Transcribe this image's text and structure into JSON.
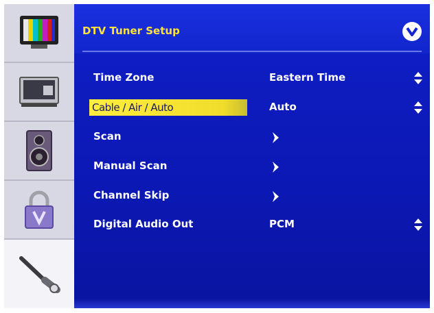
{
  "header": {
    "title": "DTV Tuner Setup",
    "logo_icon": "vizio-v-logo-icon"
  },
  "sidebar": {
    "items": [
      {
        "name": "picture",
        "icon": "color-bars-tv-icon",
        "active": false
      },
      {
        "name": "input",
        "icon": "monitor-input-icon",
        "active": false
      },
      {
        "name": "audio",
        "icon": "speaker-icon",
        "active": false
      },
      {
        "name": "parental",
        "icon": "padlock-icon",
        "active": false
      },
      {
        "name": "setup",
        "icon": "wrench-icon",
        "active": true
      }
    ]
  },
  "menu": {
    "items": [
      {
        "label": "Time Zone",
        "value": "Eastern Time",
        "control": "updown",
        "selected": false
      },
      {
        "label": "Cable / Air / Auto",
        "value": "Auto",
        "control": "updown",
        "selected": true
      },
      {
        "label": "Scan",
        "value": "",
        "control": "arrow",
        "selected": false
      },
      {
        "label": "Manual Scan",
        "value": "",
        "control": "arrow",
        "selected": false
      },
      {
        "label": "Channel Skip",
        "value": "",
        "control": "arrow",
        "selected": false
      },
      {
        "label": "Digital Audio Out",
        "value": "PCM",
        "control": "updown",
        "selected": false
      }
    ]
  },
  "colors": {
    "panel": "#1020c8",
    "title": "#ffe23a",
    "highlight": "#ffee40",
    "sidebar": "#d8d8e4"
  }
}
